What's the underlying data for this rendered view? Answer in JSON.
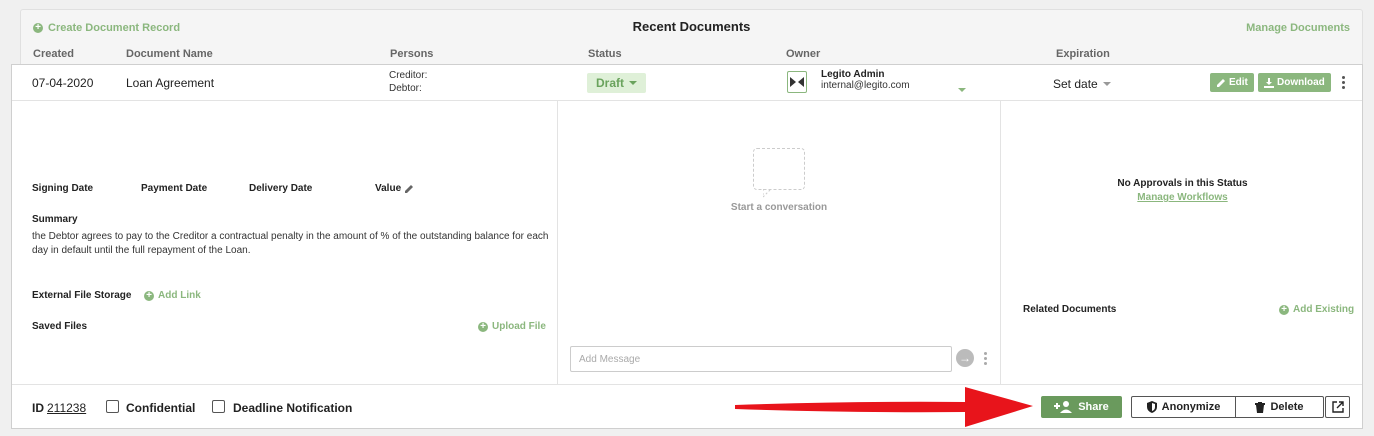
{
  "header": {
    "create_label": "Create Document Record",
    "title": "Recent Documents",
    "manage_label": "Manage Documents"
  },
  "columns": {
    "created": "Created",
    "document_name": "Document Name",
    "persons": "Persons",
    "status": "Status",
    "owner": "Owner",
    "expiration": "Expiration"
  },
  "record": {
    "created": "07-04-2020",
    "name": "Loan Agreement",
    "persons": [
      "Creditor:",
      "Debtor:"
    ],
    "status": "Draft",
    "owner_name": "Legito Admin",
    "owner_email": "internal@legito.com",
    "expiration": "Set date",
    "edit_label": "Edit",
    "download_label": "Download"
  },
  "details": {
    "signing_date": "Signing Date",
    "payment_date": "Payment Date",
    "delivery_date": "Delivery Date",
    "value": "Value",
    "summary_label": "Summary",
    "summary_text": "the Debtor agrees to pay to the Creditor a contractual penalty in the amount of % of the outstanding balance for each day in default until the full repayment of the Loan.",
    "external_storage": "External File Storage",
    "add_link": "Add Link",
    "saved_files": "Saved Files",
    "upload_file": "Upload File"
  },
  "conversation": {
    "start_label": "Start a conversation",
    "message_placeholder": "Add Message"
  },
  "approvals": {
    "no_approvals": "No Approvals in this Status",
    "manage_workflows": "Manage Workflows",
    "related_documents": "Related Documents",
    "add_existing": "Add Existing"
  },
  "footer": {
    "id_label": "ID",
    "id_value": "211238",
    "confidential": "Confidential",
    "deadline_notification": "Deadline Notification",
    "share": "Share",
    "anonymize": "Anonymize",
    "delete": "Delete"
  },
  "colors": {
    "accent": "#8bb77e",
    "share_button": "#6a9a5d",
    "arrow": "#e8141b"
  },
  "icons": [
    "plus-circle-icon",
    "caret-down-icon",
    "legito-logo-icon",
    "pencil-icon",
    "download-icon",
    "kebab-icon",
    "speech-bubble-icon",
    "arrow-right-circle-icon",
    "add-user-icon",
    "shield-icon",
    "trash-icon",
    "external-link-icon",
    "red-arrow-annotation"
  ]
}
